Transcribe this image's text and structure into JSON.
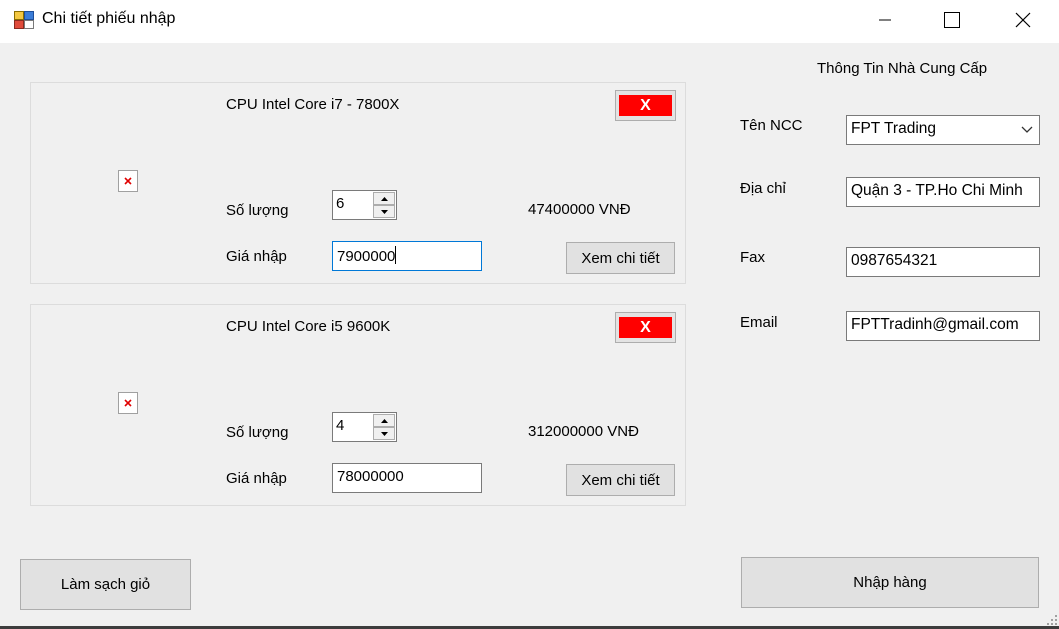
{
  "window": {
    "title": "Chi tiết phiếu nhập"
  },
  "items": [
    {
      "name": "CPU Intel Core i7 - 7800X",
      "qty_label": "Số lượng",
      "qty": "6",
      "total": "47400000 VNĐ",
      "price_label": "Giá nhập",
      "price": "7900000",
      "detail_label": "Xem chi tiết",
      "remove_label": "X"
    },
    {
      "name": "CPU Intel Core i5 9600K",
      "qty_label": "Số lượng",
      "qty": "4",
      "total": "312000000 VNĐ",
      "price_label": "Giá nhập",
      "price": "78000000",
      "detail_label": "Xem chi tiết",
      "remove_label": "X"
    }
  ],
  "supplier": {
    "title": "Thông Tin Nhà Cung Cấp",
    "name_label": "Tên NCC",
    "name_value": "FPT Trading",
    "address_label": "Địa chỉ",
    "address_value": "Quận 3 - TP.Ho Chi Minh",
    "fax_label": "Fax",
    "fax_value": "0987654321",
    "email_label": "Email",
    "email_value": "FPTTradinh@gmail.com"
  },
  "actions": {
    "clear_label": "Làm sạch giỏ",
    "import_label": "Nhập hàng"
  },
  "colors": {
    "remove_red": "#ff0000",
    "focus_blue": "#0078d7",
    "window_bg": "#f0f0f0"
  }
}
